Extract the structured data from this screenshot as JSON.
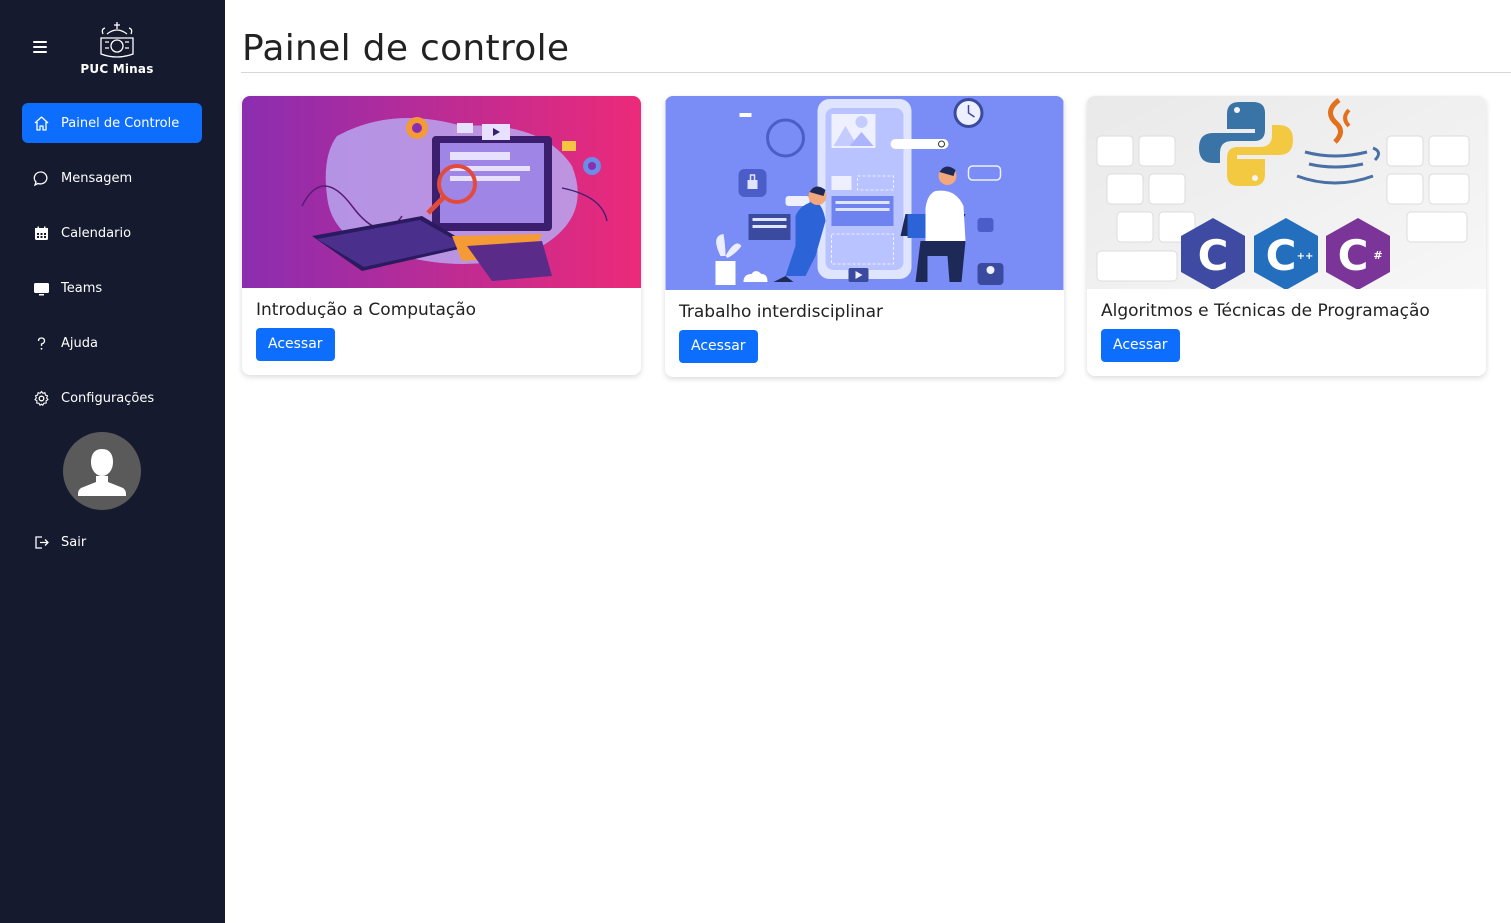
{
  "sidebar": {
    "logo_text": "PUC Minas",
    "items": [
      {
        "label": "Painel de Controle",
        "icon": "home-icon",
        "active": true
      },
      {
        "label": "Mensagem",
        "icon": "chat-icon"
      },
      {
        "label": "Calendario",
        "icon": "calendar-icon"
      },
      {
        "label": "Teams",
        "icon": "monitor-icon"
      },
      {
        "label": "Ajuda",
        "icon": "question-icon"
      },
      {
        "label": "Configurações",
        "icon": "gear-icon"
      }
    ],
    "logout_label": "Sair"
  },
  "main": {
    "title": "Painel de controle",
    "cards": [
      {
        "title": "Introdução a Computação",
        "button": "Acessar"
      },
      {
        "title": "Trabalho interdisciplinar",
        "button": "Acessar"
      },
      {
        "title": "Algoritmos e Técnicas de Programação",
        "button": "Acessar"
      }
    ]
  },
  "colors": {
    "sidebar_bg": "#151a2e",
    "accent": "#0d6efd"
  }
}
